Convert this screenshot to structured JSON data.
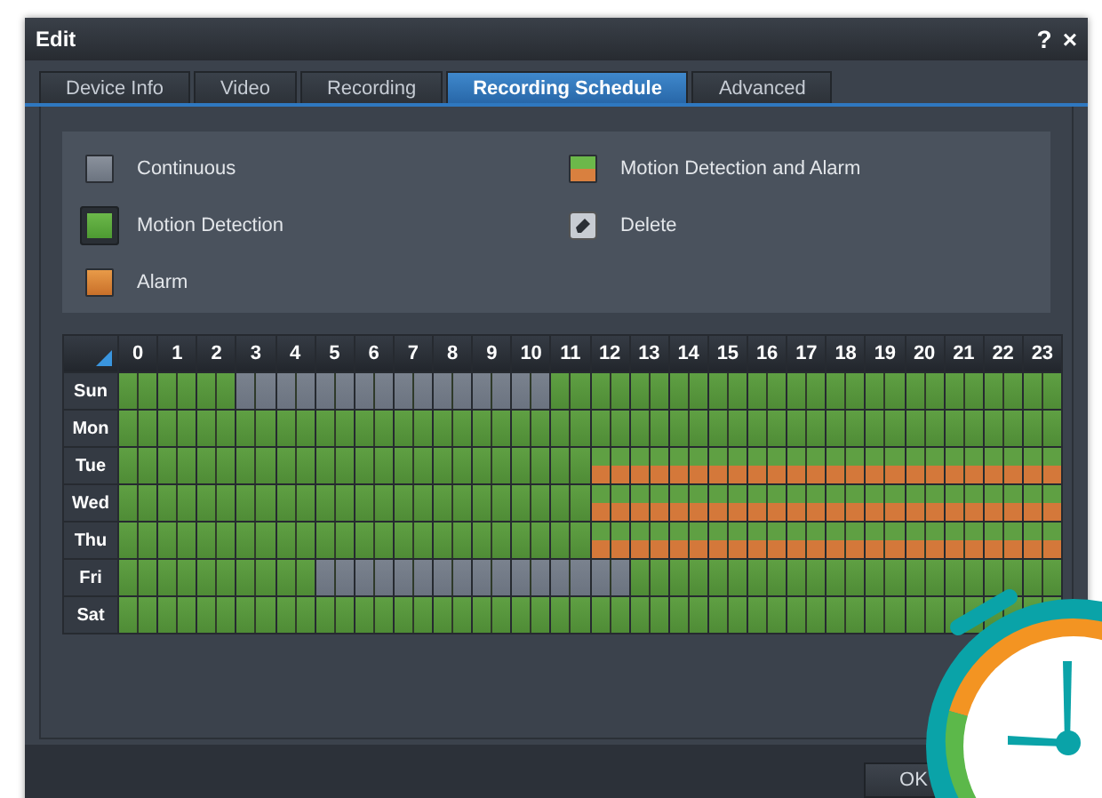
{
  "window": {
    "title": "Edit",
    "help": "?",
    "close": "×"
  },
  "tabs": [
    {
      "label": "Device Info",
      "selected": false
    },
    {
      "label": "Video",
      "selected": false
    },
    {
      "label": "Recording",
      "selected": false
    },
    {
      "label": "Recording Schedule",
      "selected": true
    },
    {
      "label": "Advanced",
      "selected": false
    }
  ],
  "legend": [
    {
      "kind": "continuous",
      "label": "Continuous",
      "selected": false
    },
    {
      "kind": "motion_alarm",
      "label": "Motion Detection and Alarm",
      "selected": false
    },
    {
      "kind": "motion",
      "label": "Motion Detection",
      "selected": true
    },
    {
      "kind": "delete",
      "label": "Delete",
      "selected": false
    },
    {
      "kind": "alarm",
      "label": "Alarm",
      "selected": false
    }
  ],
  "schedule": {
    "hours": [
      "0",
      "1",
      "2",
      "3",
      "4",
      "5",
      "6",
      "7",
      "8",
      "9",
      "10",
      "11",
      "12",
      "13",
      "14",
      "15",
      "16",
      "17",
      "18",
      "19",
      "20",
      "21",
      "22",
      "23"
    ],
    "days": [
      {
        "day": "Sun",
        "slots": [
          {
            "kind": "motion"
          },
          {
            "kind": "motion"
          },
          {
            "kind": "motion"
          },
          {
            "kind": "continuous"
          },
          {
            "kind": "continuous"
          },
          {
            "kind": "continuous"
          },
          {
            "kind": "continuous"
          },
          {
            "kind": "continuous"
          },
          {
            "kind": "continuous"
          },
          {
            "kind": "continuous"
          },
          {
            "kind": "continuous"
          },
          {
            "kind": "motion"
          },
          {
            "kind": "motion"
          },
          {
            "kind": "motion"
          },
          {
            "kind": "motion"
          },
          {
            "kind": "motion"
          },
          {
            "kind": "motion"
          },
          {
            "kind": "motion"
          },
          {
            "kind": "motion"
          },
          {
            "kind": "motion"
          },
          {
            "kind": "motion"
          },
          {
            "kind": "motion"
          },
          {
            "kind": "motion"
          },
          {
            "kind": "motion"
          }
        ]
      },
      {
        "day": "Mon",
        "slots": [
          {
            "kind": "motion"
          },
          {
            "kind": "motion"
          },
          {
            "kind": "motion"
          },
          {
            "kind": "motion"
          },
          {
            "kind": "motion"
          },
          {
            "kind": "motion"
          },
          {
            "kind": "motion"
          },
          {
            "kind": "motion"
          },
          {
            "kind": "motion"
          },
          {
            "kind": "motion"
          },
          {
            "kind": "motion"
          },
          {
            "kind": "motion"
          },
          {
            "kind": "motion"
          },
          {
            "kind": "motion"
          },
          {
            "kind": "motion"
          },
          {
            "kind": "motion"
          },
          {
            "kind": "motion"
          },
          {
            "kind": "motion"
          },
          {
            "kind": "motion"
          },
          {
            "kind": "motion"
          },
          {
            "kind": "motion"
          },
          {
            "kind": "motion"
          },
          {
            "kind": "motion"
          },
          {
            "kind": "motion"
          }
        ]
      },
      {
        "day": "Tue",
        "slots": [
          {
            "kind": "motion"
          },
          {
            "kind": "motion"
          },
          {
            "kind": "motion"
          },
          {
            "kind": "motion"
          },
          {
            "kind": "motion"
          },
          {
            "kind": "motion"
          },
          {
            "kind": "motion"
          },
          {
            "kind": "motion"
          },
          {
            "kind": "motion"
          },
          {
            "kind": "motion"
          },
          {
            "kind": "motion"
          },
          {
            "kind": "motion"
          },
          {
            "kind": "motion_alarm"
          },
          {
            "kind": "motion_alarm"
          },
          {
            "kind": "motion_alarm"
          },
          {
            "kind": "motion_alarm"
          },
          {
            "kind": "motion_alarm"
          },
          {
            "kind": "motion_alarm"
          },
          {
            "kind": "motion_alarm"
          },
          {
            "kind": "motion_alarm"
          },
          {
            "kind": "motion_alarm"
          },
          {
            "kind": "motion_alarm"
          },
          {
            "kind": "motion_alarm"
          },
          {
            "kind": "motion_alarm"
          }
        ]
      },
      {
        "day": "Wed",
        "slots": [
          {
            "kind": "motion"
          },
          {
            "kind": "motion"
          },
          {
            "kind": "motion"
          },
          {
            "kind": "motion"
          },
          {
            "kind": "motion"
          },
          {
            "kind": "motion"
          },
          {
            "kind": "motion"
          },
          {
            "kind": "motion"
          },
          {
            "kind": "motion"
          },
          {
            "kind": "motion"
          },
          {
            "kind": "motion"
          },
          {
            "kind": "motion"
          },
          {
            "kind": "motion_alarm"
          },
          {
            "kind": "motion_alarm"
          },
          {
            "kind": "motion_alarm"
          },
          {
            "kind": "motion_alarm"
          },
          {
            "kind": "motion_alarm"
          },
          {
            "kind": "motion_alarm"
          },
          {
            "kind": "motion_alarm"
          },
          {
            "kind": "motion_alarm"
          },
          {
            "kind": "motion_alarm"
          },
          {
            "kind": "motion_alarm"
          },
          {
            "kind": "motion_alarm"
          },
          {
            "kind": "motion_alarm"
          }
        ]
      },
      {
        "day": "Thu",
        "slots": [
          {
            "kind": "motion"
          },
          {
            "kind": "motion"
          },
          {
            "kind": "motion"
          },
          {
            "kind": "motion"
          },
          {
            "kind": "motion"
          },
          {
            "kind": "motion"
          },
          {
            "kind": "motion"
          },
          {
            "kind": "motion"
          },
          {
            "kind": "motion"
          },
          {
            "kind": "motion"
          },
          {
            "kind": "motion"
          },
          {
            "kind": "motion"
          },
          {
            "kind": "motion_alarm"
          },
          {
            "kind": "motion_alarm"
          },
          {
            "kind": "motion_alarm"
          },
          {
            "kind": "motion_alarm"
          },
          {
            "kind": "motion_alarm"
          },
          {
            "kind": "motion_alarm"
          },
          {
            "kind": "motion_alarm"
          },
          {
            "kind": "motion_alarm"
          },
          {
            "kind": "motion_alarm"
          },
          {
            "kind": "motion_alarm"
          },
          {
            "kind": "motion_alarm"
          },
          {
            "kind": "motion_alarm"
          }
        ]
      },
      {
        "day": "Fri",
        "slots": [
          {
            "kind": "motion"
          },
          {
            "kind": "motion"
          },
          {
            "kind": "motion"
          },
          {
            "kind": "motion"
          },
          {
            "kind": "motion"
          },
          {
            "kind": "continuous"
          },
          {
            "kind": "continuous"
          },
          {
            "kind": "continuous"
          },
          {
            "kind": "continuous"
          },
          {
            "kind": "continuous"
          },
          {
            "kind": "continuous"
          },
          {
            "kind": "continuous"
          },
          {
            "kind": "continuous"
          },
          {
            "kind": "motion"
          },
          {
            "kind": "motion"
          },
          {
            "kind": "motion"
          },
          {
            "kind": "motion"
          },
          {
            "kind": "motion"
          },
          {
            "kind": "motion"
          },
          {
            "kind": "motion"
          },
          {
            "kind": "motion"
          },
          {
            "kind": "motion"
          },
          {
            "kind": "motion"
          },
          {
            "kind": "motion"
          }
        ]
      },
      {
        "day": "Sat",
        "slots": [
          {
            "kind": "motion"
          },
          {
            "kind": "motion"
          },
          {
            "kind": "motion"
          },
          {
            "kind": "motion"
          },
          {
            "kind": "motion"
          },
          {
            "kind": "motion"
          },
          {
            "kind": "motion"
          },
          {
            "kind": "motion"
          },
          {
            "kind": "motion"
          },
          {
            "kind": "motion"
          },
          {
            "kind": "motion"
          },
          {
            "kind": "motion"
          },
          {
            "kind": "motion"
          },
          {
            "kind": "motion"
          },
          {
            "kind": "motion"
          },
          {
            "kind": "motion"
          },
          {
            "kind": "motion"
          },
          {
            "kind": "motion"
          },
          {
            "kind": "motion"
          },
          {
            "kind": "motion"
          },
          {
            "kind": "motion"
          },
          {
            "kind": "motion"
          },
          {
            "kind": "motion"
          },
          {
            "kind": "motion"
          }
        ]
      }
    ]
  },
  "buttons": [
    {
      "label": "OK"
    }
  ]
}
